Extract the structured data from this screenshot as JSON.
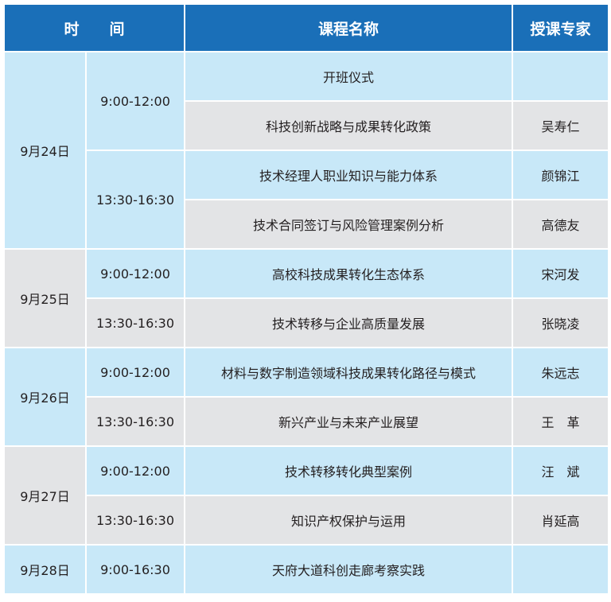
{
  "header": {
    "time": "时　　间",
    "course": "课程名称",
    "expert": "授课专家"
  },
  "rows": [
    {
      "date": "9月24日",
      "time": "9:00-12:00",
      "course": "开班仪式",
      "expert": ""
    },
    {
      "date": "",
      "time": "",
      "course": "科技创新战略与成果转化政策",
      "expert": "吴寿仁"
    },
    {
      "date": "",
      "time": "13:30-16:30",
      "course": "技术经理人职业知识与能力体系",
      "expert": "颜锦江"
    },
    {
      "date": "",
      "time": "",
      "course": "技术合同签订与风险管理案例分析",
      "expert": "高德友"
    },
    {
      "date": "9月25日",
      "time": "9:00-12:00",
      "course": "高校科技成果转化生态体系",
      "expert": "宋河发"
    },
    {
      "date": "",
      "time": "13:30-16:30",
      "course": "技术转移与企业高质量发展",
      "expert": "张晓凌"
    },
    {
      "date": "9月26日",
      "time": "9:00-12:00",
      "course": "材料与数字制造领域科技成果转化路径与模式",
      "expert": "朱远志"
    },
    {
      "date": "",
      "time": "13:30-16:30",
      "course": "新兴产业与未来产业展望",
      "expert": "王　革"
    },
    {
      "date": "9月27日",
      "time": "9:00-12:00",
      "course": "技术转移转化典型案例",
      "expert": "汪　斌"
    },
    {
      "date": "",
      "time": "13:30-16:30",
      "course": "知识产权保护与运用",
      "expert": "肖延高"
    },
    {
      "date": "9月28日",
      "time": "9:00-16:30",
      "course": "天府大道科创走廊考察实践",
      "expert": ""
    }
  ],
  "colors": {
    "header": "#1a6fb8",
    "header_text": "#ffffff",
    "blue_cell": "#c8e8f8",
    "gray_cell": "#e3e4e6",
    "text": "#231f20"
  }
}
